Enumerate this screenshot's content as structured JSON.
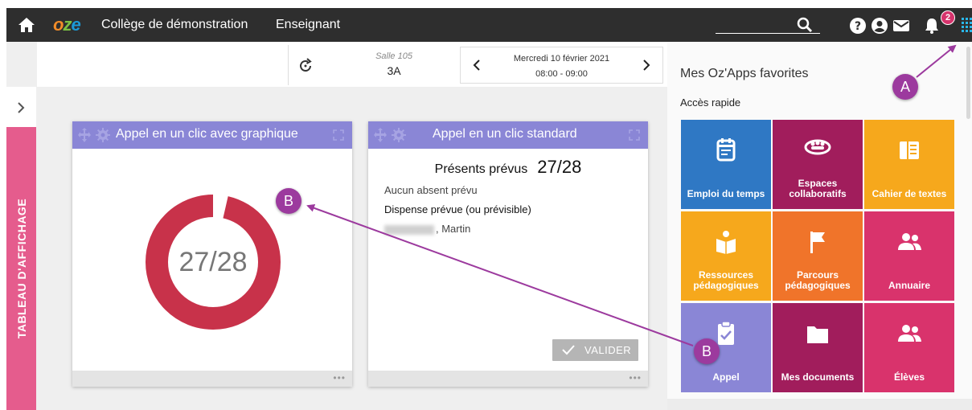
{
  "topbar": {
    "logo": "oze",
    "school": "Collège de démonstration",
    "role": "Enseignant",
    "notification_count": "2"
  },
  "side_tab": {
    "label": "TABLEAU D'AFFICHAGE"
  },
  "header": {
    "room_label": "Salle 105",
    "room_value": "3A",
    "date": "Mercredi 10 février 2021",
    "time": "08:00 - 09:00"
  },
  "card1": {
    "title": "Appel en un clic avec graphique",
    "donut_text": "27/28",
    "present": 27,
    "total": 28,
    "ring_color": "#c8324a"
  },
  "card2": {
    "title": "Appel en un clic standard",
    "presents_label": "Présents prévus",
    "presents_value": "27/28",
    "no_absent": "Aucun absent prévu",
    "dispense_label": "Dispense prévue (ou prévisible)",
    "dispense_name": ", Martin",
    "validate_label": "VALIDER"
  },
  "panel": {
    "title": "Mes Oz'Apps favorites",
    "subtitle": "Accès rapide",
    "tiles": [
      {
        "label": "Emploi du temps",
        "color": "#2f78c4",
        "icon": "calendar-icon"
      },
      {
        "label": "Espaces collaboratifs",
        "color": "#a11d5c",
        "icon": "group-icon"
      },
      {
        "label": "Cahier de textes",
        "color": "#f6a81c",
        "icon": "book-icon"
      },
      {
        "label": "Ressources pédagogiques",
        "color": "#f6a81c",
        "icon": "reader-icon"
      },
      {
        "label": "Parcours pédagogiques",
        "color": "#f0742a",
        "icon": "flag-icon"
      },
      {
        "label": "Annuaire",
        "color": "#d9336c",
        "icon": "people-icon"
      },
      {
        "label": "Appel",
        "color": "#8a86d6",
        "icon": "clipboard-check-icon"
      },
      {
        "label": "Mes documents",
        "color": "#a11d5c",
        "icon": "folder-icon"
      },
      {
        "label": "Élèves",
        "color": "#d9336c",
        "icon": "students-icon"
      }
    ]
  },
  "annotations": {
    "a": "A",
    "b1": "B",
    "b2": "B"
  },
  "colors": {
    "accent": "#8a86d6",
    "marker": "#9c3a9e",
    "topbar": "#2e2e2e"
  }
}
